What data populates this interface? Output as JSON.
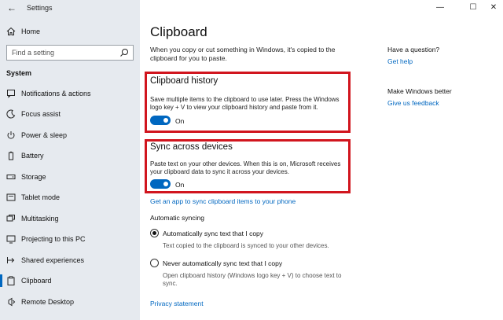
{
  "window": {
    "title": "Settings",
    "minimize_glyph": "—",
    "maximize_glyph": "☐",
    "close_glyph": "✕"
  },
  "sidebar": {
    "back_glyph": "←",
    "home_label": "Home",
    "search_placeholder": "Find a setting",
    "section_label": "System",
    "items": [
      {
        "label": "Notifications & actions",
        "icon": "notifications-icon"
      },
      {
        "label": "Focus assist",
        "icon": "moon-icon"
      },
      {
        "label": "Power & sleep",
        "icon": "power-icon"
      },
      {
        "label": "Battery",
        "icon": "battery-icon"
      },
      {
        "label": "Storage",
        "icon": "storage-icon"
      },
      {
        "label": "Tablet mode",
        "icon": "tablet-icon"
      },
      {
        "label": "Multitasking",
        "icon": "multitasking-icon"
      },
      {
        "label": "Projecting to this PC",
        "icon": "projecting-icon"
      },
      {
        "label": "Shared experiences",
        "icon": "shared-experiences-icon"
      },
      {
        "label": "Clipboard",
        "icon": "clipboard-icon"
      },
      {
        "label": "Remote Desktop",
        "icon": "remote-desktop-icon"
      }
    ],
    "active_index": 9
  },
  "main": {
    "title": "Clipboard",
    "intro": "When you copy or cut something in Windows, it's copied to the clipboard for you to paste.",
    "history": {
      "heading": "Clipboard history",
      "description": "Save multiple items to the clipboard to use later. Press the Windows logo key + V to view your clipboard history and paste from it.",
      "toggle_label": "On"
    },
    "sync": {
      "heading": "Sync across devices",
      "description": "Paste text on your other devices. When this is on, Microsoft receives your clipboard data to sync it across your devices.",
      "toggle_label": "On"
    },
    "get_app_link": "Get an app to sync clipboard items to your phone",
    "auto_sync_heading": "Automatic syncing",
    "radio_auto": {
      "label": "Automatically sync text that I copy",
      "description": "Text copied to the clipboard is synced to your other devices."
    },
    "radio_never": {
      "label": "Never automatically sync text that I copy",
      "description": "Open clipboard history (Windows logo key + V) to choose text to sync."
    },
    "privacy_link": "Privacy statement"
  },
  "aside": {
    "question_heading": "Have a question?",
    "help_link": "Get help",
    "better_heading": "Make Windows better",
    "feedback_link": "Give us feedback"
  },
  "colors": {
    "accent": "#0067c0",
    "highlight_box": "#d1151e",
    "sidebar_bg": "#e6eaef"
  }
}
